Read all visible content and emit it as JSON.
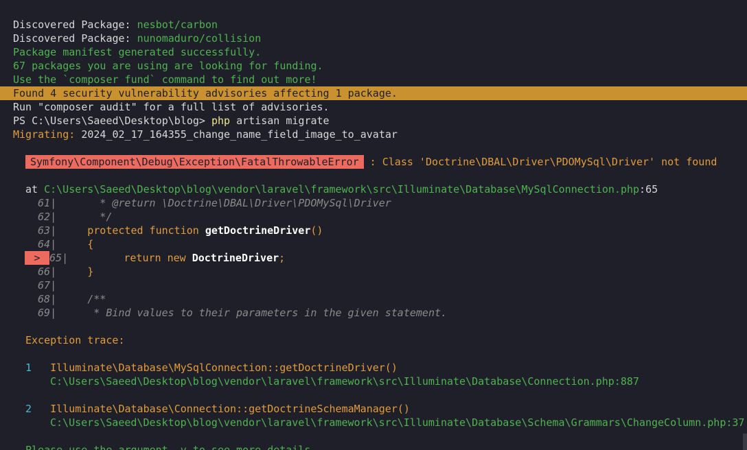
{
  "lines": {
    "l1a": "Discovered Package: ",
    "l1b": "nesbot/carbon",
    "l2a": "Discovered Package: ",
    "l2b": "nunomaduro/collision",
    "l3": "Package manifest generated successfully.",
    "l4": "67 packages you are using are looking for funding.",
    "l5": "Use the `composer fund` command to find out more!",
    "l6": "Found 4 security vulnerability advisories affecting 1 package.",
    "l7": "Run \"composer audit\" for a full list of advisories.",
    "l8a": "PS C:\\Users\\Saeed\\Desktop\\blog> ",
    "l8b": "php",
    "l8c": " artisan migrate",
    "l9a": "Migrating:",
    "l9b": " 2024_02_17_164355_change_name_field_image_to_avatar"
  },
  "error": {
    "class": "Symfony\\Component\\Debug\\Exception\\FatalThrowableError",
    "message": " : Class 'Doctrine\\DBAL\\Driver\\PDOMySql\\Driver' not found"
  },
  "location": {
    "at": "at ",
    "path": "C:\\Users\\Saeed\\Desktop\\blog\\vendor\\laravel\\framework\\src\\Illuminate\\Database\\MySqlConnection.php",
    "line": ":65"
  },
  "code": {
    "n61": "61",
    "c61": "       * @return \\Doctrine\\DBAL\\Driver\\PDOMySql\\Driver",
    "n62": "62",
    "c62": "       */",
    "n63": "63",
    "c63a": "     protected function ",
    "c63b": "getDoctrineDriver",
    "c63c": "()",
    "n64": "64",
    "c64": "     {",
    "marker": ">",
    "n65": "65",
    "c65a": "         return new ",
    "c65b": "DoctrineDriver",
    "c65c": ";",
    "n66": "66",
    "c66": "     }",
    "n67": "67",
    "n68": "68",
    "c68": "     /**",
    "n69": "69",
    "c69": "      * Bind values to their parameters in the given statement."
  },
  "trace": {
    "title": "Exception trace:",
    "items": [
      {
        "num": "1",
        "method": "Illuminate\\Database\\MySqlConnection::getDoctrineDriver()",
        "path": "C:\\Users\\Saeed\\Desktop\\blog\\vendor\\laravel\\framework\\src\\Illuminate\\Database\\Connection.php:887"
      },
      {
        "num": "2",
        "method": "Illuminate\\Database\\Connection::getDoctrineSchemaManager()",
        "path": "C:\\Users\\Saeed\\Desktop\\blog\\vendor\\laravel\\framework\\src\\Illuminate\\Database\\Schema\\Grammars\\ChangeColumn.php:37"
      }
    ]
  },
  "footer": "Please use the argument -v to see more details."
}
